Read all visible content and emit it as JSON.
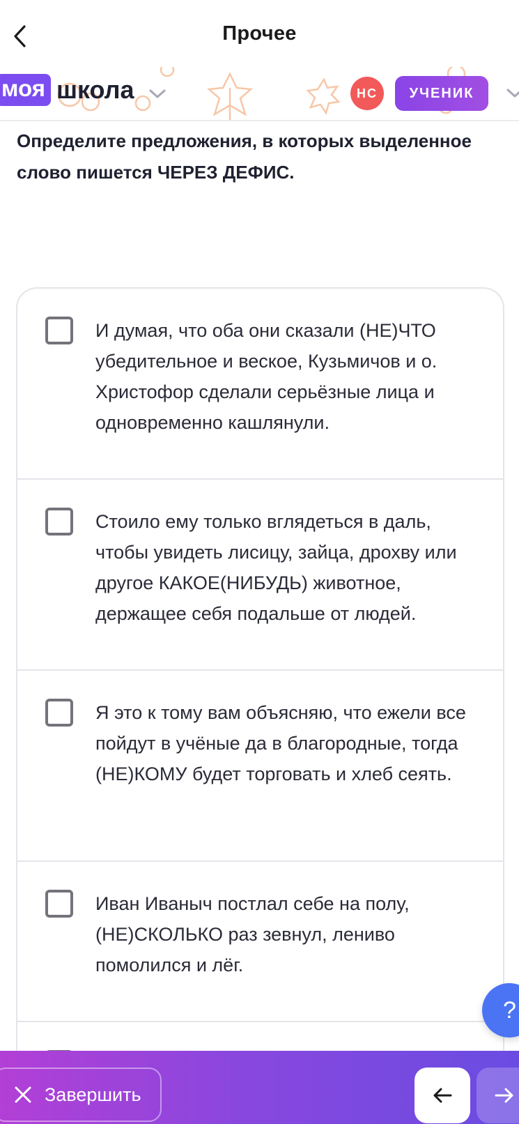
{
  "header": {
    "title": "Прочее"
  },
  "brand": {
    "highlight": "моя",
    "name": "школа"
  },
  "user": {
    "initials": "НС",
    "role": "УЧЕНИК"
  },
  "question": {
    "text": "Определите предложения, в которых выделенное слово пишется ЧЕРЕЗ ДЕФИС."
  },
  "options": [
    {
      "text": "И думая, что оба они сказали (НЕ)ЧТО убедительное и веское, Кузьмичов и о. Христофор сделали серьёзные лица и одновременно кашлянули.",
      "checked": false
    },
    {
      "text": "Стоило ему только вглядеться в даль, чтобы увидеть лисицу, зайца, дрохву или другое КАКОЕ(НИБУДЬ) животное, держащее себя подальше от людей.",
      "checked": false
    },
    {
      "text": "Я это к тому вам объясняю, что ежели все пойдут в учёные да в благородные, тогда (НЕ)КОМУ будет торговать и хлеб сеять.",
      "checked": false
    },
    {
      "text": "Иван Иваныч постлал себе на полу, (НЕ)СКОЛЬКО раз зевнул, лениво помолился и лёг.",
      "checked": false
    }
  ],
  "help": {
    "label": "?"
  },
  "footer": {
    "finish_label": "Завершить"
  },
  "colors": {
    "brand_purple": "#7b4cf0",
    "avatar_red": "#f25a5a",
    "help_blue": "#4b74f5",
    "footer_gradient_start": "#b23fd6",
    "footer_gradient_end": "#6a4ce2"
  },
  "icons": {
    "back": "chevron-left-icon",
    "brand_dropdown": "chevron-down-icon",
    "role_dropdown": "chevron-down-icon",
    "finish": "close-icon",
    "prev": "arrow-left-icon",
    "next": "arrow-right-icon"
  }
}
